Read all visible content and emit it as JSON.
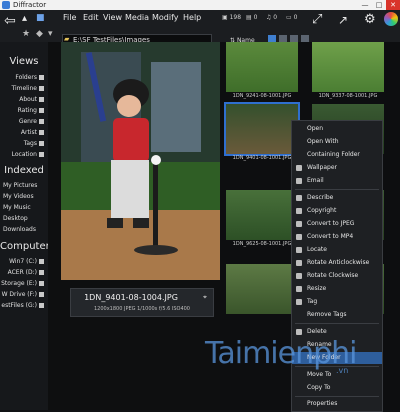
{
  "window": {
    "title": "Diffractor",
    "minimize": "—",
    "maximize": "□",
    "close": "✕"
  },
  "menu": [
    "File",
    "Edit",
    "View",
    "Media",
    "Modify",
    "Help"
  ],
  "toolbar": {
    "path": "E:\\SF TestFiles\\Images",
    "stat_count": "198",
    "stat_a": "0",
    "stat_b": "0",
    "stat_c": "0",
    "sort_label": "Name"
  },
  "sidebar": {
    "views_title": "Views",
    "views": [
      "Folders",
      "Timeline",
      "About",
      "Rating",
      "Genre",
      "Artist",
      "Tags",
      "Location"
    ],
    "indexed_title": "Indexed",
    "indexed": [
      "My Pictures",
      "My Videos",
      "My Music",
      "Desktop",
      "Downloads"
    ],
    "computer_title": "Computer",
    "computer": [
      "Win7 (C:)",
      "ACER (D:)",
      "Storage (E:)",
      "W Drive (F:)",
      "estFiles (G:)"
    ]
  },
  "viewer": {
    "filename": "1DN_9401-08-1004.JPG",
    "meta": "1200x1800 JPEG 1/1000s f/5.6 ISO400"
  },
  "thumbs": [
    {
      "label": "1DN_9241-08-1001.JPG"
    },
    {
      "label": "1DN_9337-08-1001.JPG"
    },
    {
      "label": "1DN_9401-08-1001.JPG"
    },
    {
      "label": ""
    },
    {
      "label": "1DN_9625-08-1001.JPG"
    },
    {
      "label": ""
    },
    {
      "label": ""
    },
    {
      "label": ""
    }
  ],
  "context_menu": [
    "Open",
    "Open With",
    "Containing Folder",
    "Wallpaper",
    "Email",
    "Describe",
    "Copyright",
    "Convert to JPEG",
    "Convert to MP4",
    "Locate",
    "Rotate Anticlockwise",
    "Rotate Clockwise",
    "Resize",
    "Tag",
    "Remove Tags",
    "Delete",
    "Rename",
    "New Folder",
    "Move To",
    "Copy To",
    "Properties"
  ],
  "watermark": {
    "main": "Taimienphi",
    "sub": ".vn"
  }
}
